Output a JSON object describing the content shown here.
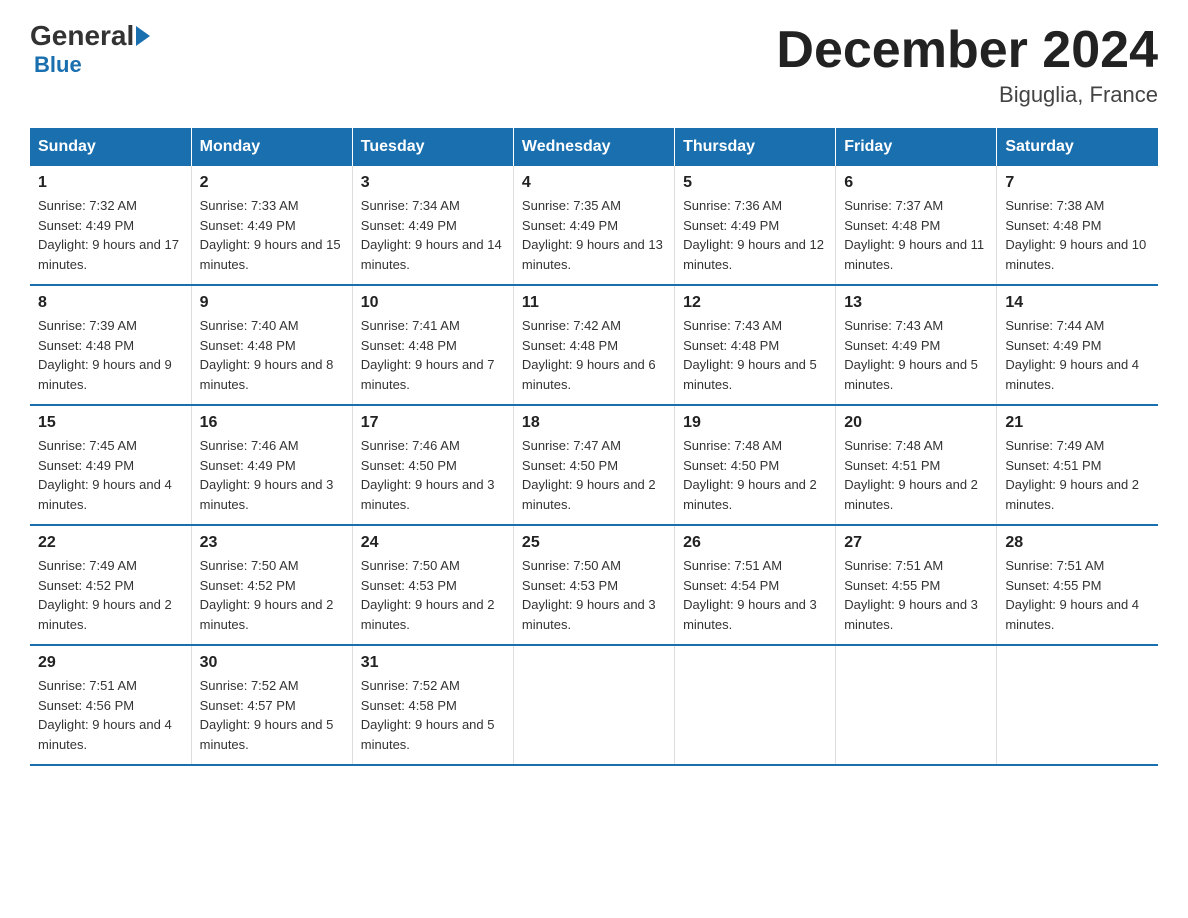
{
  "header": {
    "logo_general": "General",
    "logo_blue": "Blue",
    "month_title": "December 2024",
    "location": "Biguglia, France"
  },
  "days_of_week": [
    "Sunday",
    "Monday",
    "Tuesday",
    "Wednesday",
    "Thursday",
    "Friday",
    "Saturday"
  ],
  "weeks": [
    [
      {
        "day": "1",
        "sunrise": "7:32 AM",
        "sunset": "4:49 PM",
        "daylight": "9 hours and 17 minutes."
      },
      {
        "day": "2",
        "sunrise": "7:33 AM",
        "sunset": "4:49 PM",
        "daylight": "9 hours and 15 minutes."
      },
      {
        "day": "3",
        "sunrise": "7:34 AM",
        "sunset": "4:49 PM",
        "daylight": "9 hours and 14 minutes."
      },
      {
        "day": "4",
        "sunrise": "7:35 AM",
        "sunset": "4:49 PM",
        "daylight": "9 hours and 13 minutes."
      },
      {
        "day": "5",
        "sunrise": "7:36 AM",
        "sunset": "4:49 PM",
        "daylight": "9 hours and 12 minutes."
      },
      {
        "day": "6",
        "sunrise": "7:37 AM",
        "sunset": "4:48 PM",
        "daylight": "9 hours and 11 minutes."
      },
      {
        "day": "7",
        "sunrise": "7:38 AM",
        "sunset": "4:48 PM",
        "daylight": "9 hours and 10 minutes."
      }
    ],
    [
      {
        "day": "8",
        "sunrise": "7:39 AM",
        "sunset": "4:48 PM",
        "daylight": "9 hours and 9 minutes."
      },
      {
        "day": "9",
        "sunrise": "7:40 AM",
        "sunset": "4:48 PM",
        "daylight": "9 hours and 8 minutes."
      },
      {
        "day": "10",
        "sunrise": "7:41 AM",
        "sunset": "4:48 PM",
        "daylight": "9 hours and 7 minutes."
      },
      {
        "day": "11",
        "sunrise": "7:42 AM",
        "sunset": "4:48 PM",
        "daylight": "9 hours and 6 minutes."
      },
      {
        "day": "12",
        "sunrise": "7:43 AM",
        "sunset": "4:48 PM",
        "daylight": "9 hours and 5 minutes."
      },
      {
        "day": "13",
        "sunrise": "7:43 AM",
        "sunset": "4:49 PM",
        "daylight": "9 hours and 5 minutes."
      },
      {
        "day": "14",
        "sunrise": "7:44 AM",
        "sunset": "4:49 PM",
        "daylight": "9 hours and 4 minutes."
      }
    ],
    [
      {
        "day": "15",
        "sunrise": "7:45 AM",
        "sunset": "4:49 PM",
        "daylight": "9 hours and 4 minutes."
      },
      {
        "day": "16",
        "sunrise": "7:46 AM",
        "sunset": "4:49 PM",
        "daylight": "9 hours and 3 minutes."
      },
      {
        "day": "17",
        "sunrise": "7:46 AM",
        "sunset": "4:50 PM",
        "daylight": "9 hours and 3 minutes."
      },
      {
        "day": "18",
        "sunrise": "7:47 AM",
        "sunset": "4:50 PM",
        "daylight": "9 hours and 2 minutes."
      },
      {
        "day": "19",
        "sunrise": "7:48 AM",
        "sunset": "4:50 PM",
        "daylight": "9 hours and 2 minutes."
      },
      {
        "day": "20",
        "sunrise": "7:48 AM",
        "sunset": "4:51 PM",
        "daylight": "9 hours and 2 minutes."
      },
      {
        "day": "21",
        "sunrise": "7:49 AM",
        "sunset": "4:51 PM",
        "daylight": "9 hours and 2 minutes."
      }
    ],
    [
      {
        "day": "22",
        "sunrise": "7:49 AM",
        "sunset": "4:52 PM",
        "daylight": "9 hours and 2 minutes."
      },
      {
        "day": "23",
        "sunrise": "7:50 AM",
        "sunset": "4:52 PM",
        "daylight": "9 hours and 2 minutes."
      },
      {
        "day": "24",
        "sunrise": "7:50 AM",
        "sunset": "4:53 PM",
        "daylight": "9 hours and 2 minutes."
      },
      {
        "day": "25",
        "sunrise": "7:50 AM",
        "sunset": "4:53 PM",
        "daylight": "9 hours and 3 minutes."
      },
      {
        "day": "26",
        "sunrise": "7:51 AM",
        "sunset": "4:54 PM",
        "daylight": "9 hours and 3 minutes."
      },
      {
        "day": "27",
        "sunrise": "7:51 AM",
        "sunset": "4:55 PM",
        "daylight": "9 hours and 3 minutes."
      },
      {
        "day": "28",
        "sunrise": "7:51 AM",
        "sunset": "4:55 PM",
        "daylight": "9 hours and 4 minutes."
      }
    ],
    [
      {
        "day": "29",
        "sunrise": "7:51 AM",
        "sunset": "4:56 PM",
        "daylight": "9 hours and 4 minutes."
      },
      {
        "day": "30",
        "sunrise": "7:52 AM",
        "sunset": "4:57 PM",
        "daylight": "9 hours and 5 minutes."
      },
      {
        "day": "31",
        "sunrise": "7:52 AM",
        "sunset": "4:58 PM",
        "daylight": "9 hours and 5 minutes."
      },
      null,
      null,
      null,
      null
    ]
  ]
}
